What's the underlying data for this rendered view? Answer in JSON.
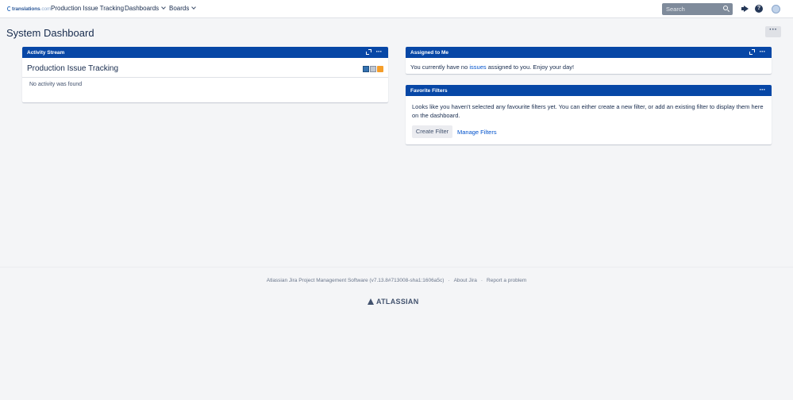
{
  "header": {
    "logo_text": "translations",
    "logo_suffix": ".com",
    "project_name": "Production Issue Tracking",
    "nav": {
      "dashboards": "Dashboards",
      "boards": "Boards"
    },
    "search_placeholder": "Search",
    "help_glyph": "?"
  },
  "page": {
    "title": "System Dashboard",
    "menu_glyph": "···"
  },
  "gadgets": {
    "activity": {
      "title": "Activity Stream",
      "stream_title": "Production Issue Tracking",
      "empty": "No activity was found"
    },
    "assigned": {
      "title": "Assigned to Me",
      "text_before": "You currently have no ",
      "link": "issues",
      "text_after": " assigned to you. Enjoy your day!"
    },
    "filters": {
      "title": "Favorite Filters",
      "text": "Looks like you haven't selected any favourite filters yet. You can either create a new filter, or add an existing filter to display them here on the dashboard.",
      "create_button": "Create Filter",
      "manage_link": "Manage Filters"
    },
    "more_glyph": "···"
  },
  "footer": {
    "version": "Atlassian Jira Project Management Software (v7.13.8#713008-sha1:1606a5c)",
    "sep": "·",
    "about": "About Jira",
    "report": "Report a problem",
    "brand": "ATLASSIAN"
  },
  "colors": {
    "header_blue": "#0747a6",
    "link_blue": "#0052cc",
    "page_bg": "#f4f5f7"
  }
}
